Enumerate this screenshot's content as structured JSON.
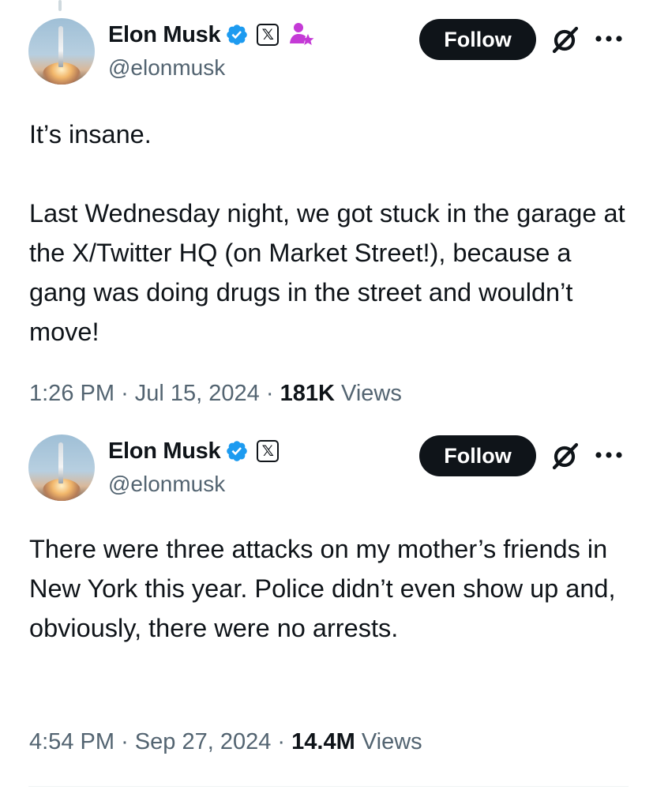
{
  "tweets": [
    {
      "author": {
        "display_name": "Elon Musk",
        "handle": "@elonmusk",
        "x_badge": "𝕏",
        "verified_color": "#1d9bf0",
        "has_affiliate_icon": true
      },
      "follow_label": "Follow",
      "text": "It’s insane.\n\nLast Wednesday night, we got stuck in the garage at the X/Twitter HQ (on Market Street!), because a gang was doing drugs in the street and wouldn’t move!",
      "time": "1:26 PM",
      "date": "Jul 15, 2024",
      "views_count": "181K",
      "views_label": "Views",
      "sep": "·"
    },
    {
      "author": {
        "display_name": "Elon Musk",
        "handle": "@elonmusk",
        "x_badge": "𝕏",
        "verified_color": "#1d9bf0",
        "has_affiliate_icon": false
      },
      "follow_label": "Follow",
      "text": "There were three attacks on my mother’s friends in New York this year. Police didn’t even show up and, obviously, there were no arrests.",
      "time": "4:54 PM",
      "date": "Sep 27, 2024",
      "views_count": "14.4M",
      "views_label": "Views",
      "sep": "·"
    }
  ],
  "icons": {
    "verified": "verified-badge-icon",
    "x_badge": "x-logo-icon",
    "affiliate": "affiliate-person-star-icon",
    "grok": "grok-icon",
    "more": "more-options-icon"
  },
  "colors": {
    "text_primary": "#0f1419",
    "text_secondary": "#536471",
    "verified_blue": "#1d9bf0",
    "affiliate_pink": "#c43ad6",
    "follow_bg": "#0f1419",
    "follow_text": "#ffffff"
  }
}
